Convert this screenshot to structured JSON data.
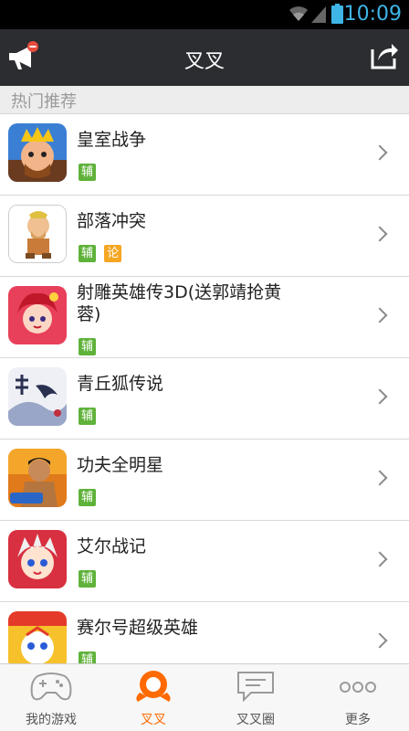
{
  "status_bar": {
    "time": "10:09"
  },
  "header": {
    "title": "叉叉"
  },
  "section": {
    "title": "热门推荐"
  },
  "colors": {
    "accent": "#ff6a00",
    "tag_fu": "#5fb23a",
    "tag_lun": "#f5a623",
    "header_bg": "#2b2d31"
  },
  "games": [
    {
      "name": "皇室战争",
      "tags": [
        "辅"
      ],
      "icon": "clash-royale-icon"
    },
    {
      "name": "部落冲突",
      "tags": [
        "辅",
        "论"
      ],
      "icon": "clash-of-clans-icon"
    },
    {
      "name": "射雕英雄传3D(送郭靖抢黄蓉)",
      "tags": [
        "辅"
      ],
      "icon": "shediao-icon"
    },
    {
      "name": "青丘狐传说",
      "tags": [
        "辅"
      ],
      "icon": "qingqiu-icon"
    },
    {
      "name": "功夫全明星",
      "tags": [
        "辅"
      ],
      "icon": "kungfu-icon"
    },
    {
      "name": "艾尔战记",
      "tags": [
        "辅"
      ],
      "icon": "aier-icon"
    },
    {
      "name": "赛尔号超级英雄",
      "tags": [
        "辅"
      ],
      "icon": "seer-icon"
    }
  ],
  "tabs": [
    {
      "label": "我的游戏",
      "icon": "gamepad-icon"
    },
    {
      "label": "叉叉",
      "icon": "chacha-logo-icon"
    },
    {
      "label": "叉叉圈",
      "icon": "chat-icon"
    },
    {
      "label": "更多",
      "icon": "more-icon"
    }
  ]
}
